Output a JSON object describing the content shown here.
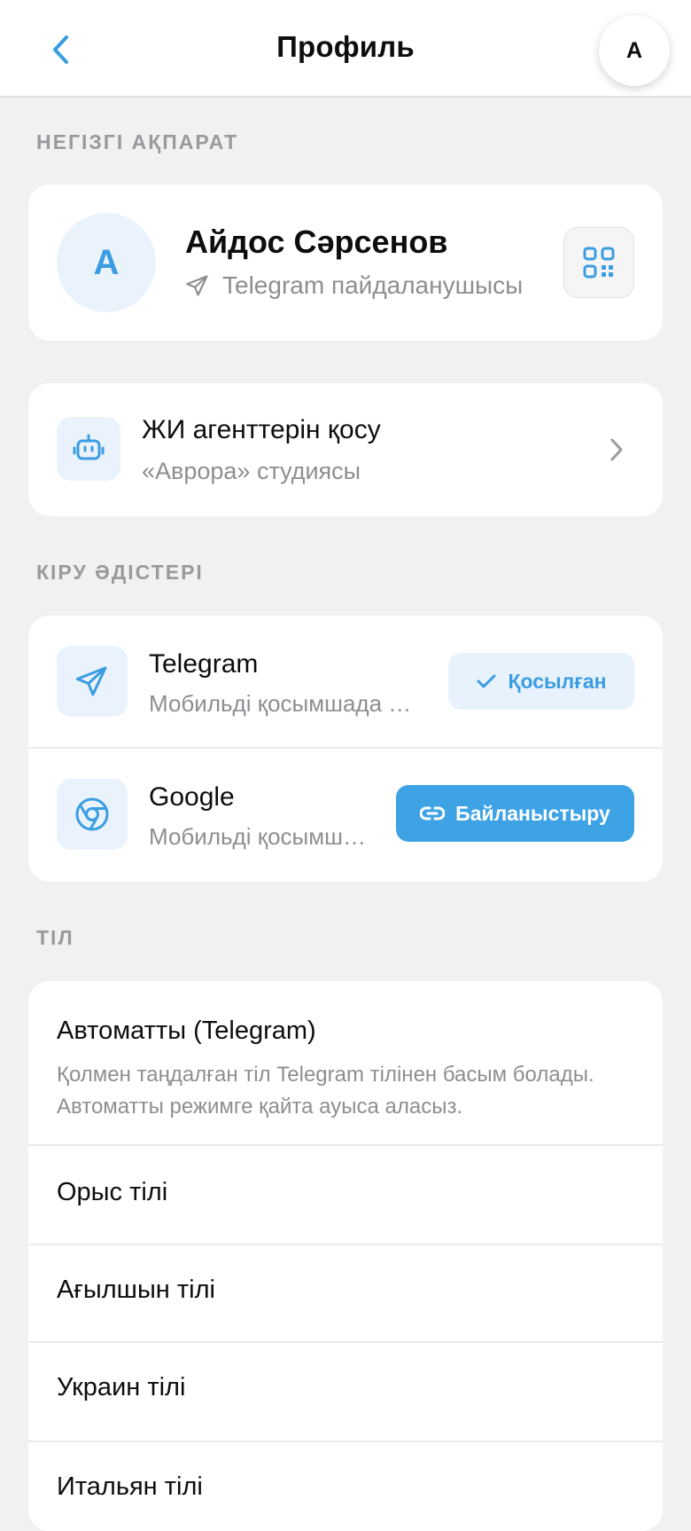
{
  "header": {
    "title": "Профиль",
    "avatar_letter": "А"
  },
  "sections": {
    "basic_info": "НЕГІЗГІ АҚПАРАТ",
    "login_methods": "КІРУ ӘДІСТЕРІ",
    "language": "ТІЛ"
  },
  "profile": {
    "initial": "А",
    "name": "Айдос Сәрсенов",
    "subtitle": "Telegram пайдаланушысы"
  },
  "agents": {
    "title": "ЖИ агенттерін қосу",
    "subtitle": "«Аврора» студиясы"
  },
  "login_methods": [
    {
      "title": "Telegram",
      "subtitle": "Мобильді қосымшада Те...",
      "button": "Қосылған"
    },
    {
      "title": "Google",
      "subtitle": "Мобильді қосымша...",
      "button": "Байланыстыру"
    }
  ],
  "languages": {
    "auto_label": "Автоматты (Telegram)",
    "auto_description": "Қолмен таңдалған тіл Telegram тілінен басым болады. Автоматты режимге қайта ауыса аласыз.",
    "items": [
      "Орыс тілі",
      "Ағылшын тілі",
      "Украин тілі",
      "Итальян тілі"
    ]
  },
  "colors": {
    "accent": "#3a9de2",
    "background": "#f1f1f2",
    "card": "#ffffff",
    "muted_text": "#8d8e93"
  }
}
